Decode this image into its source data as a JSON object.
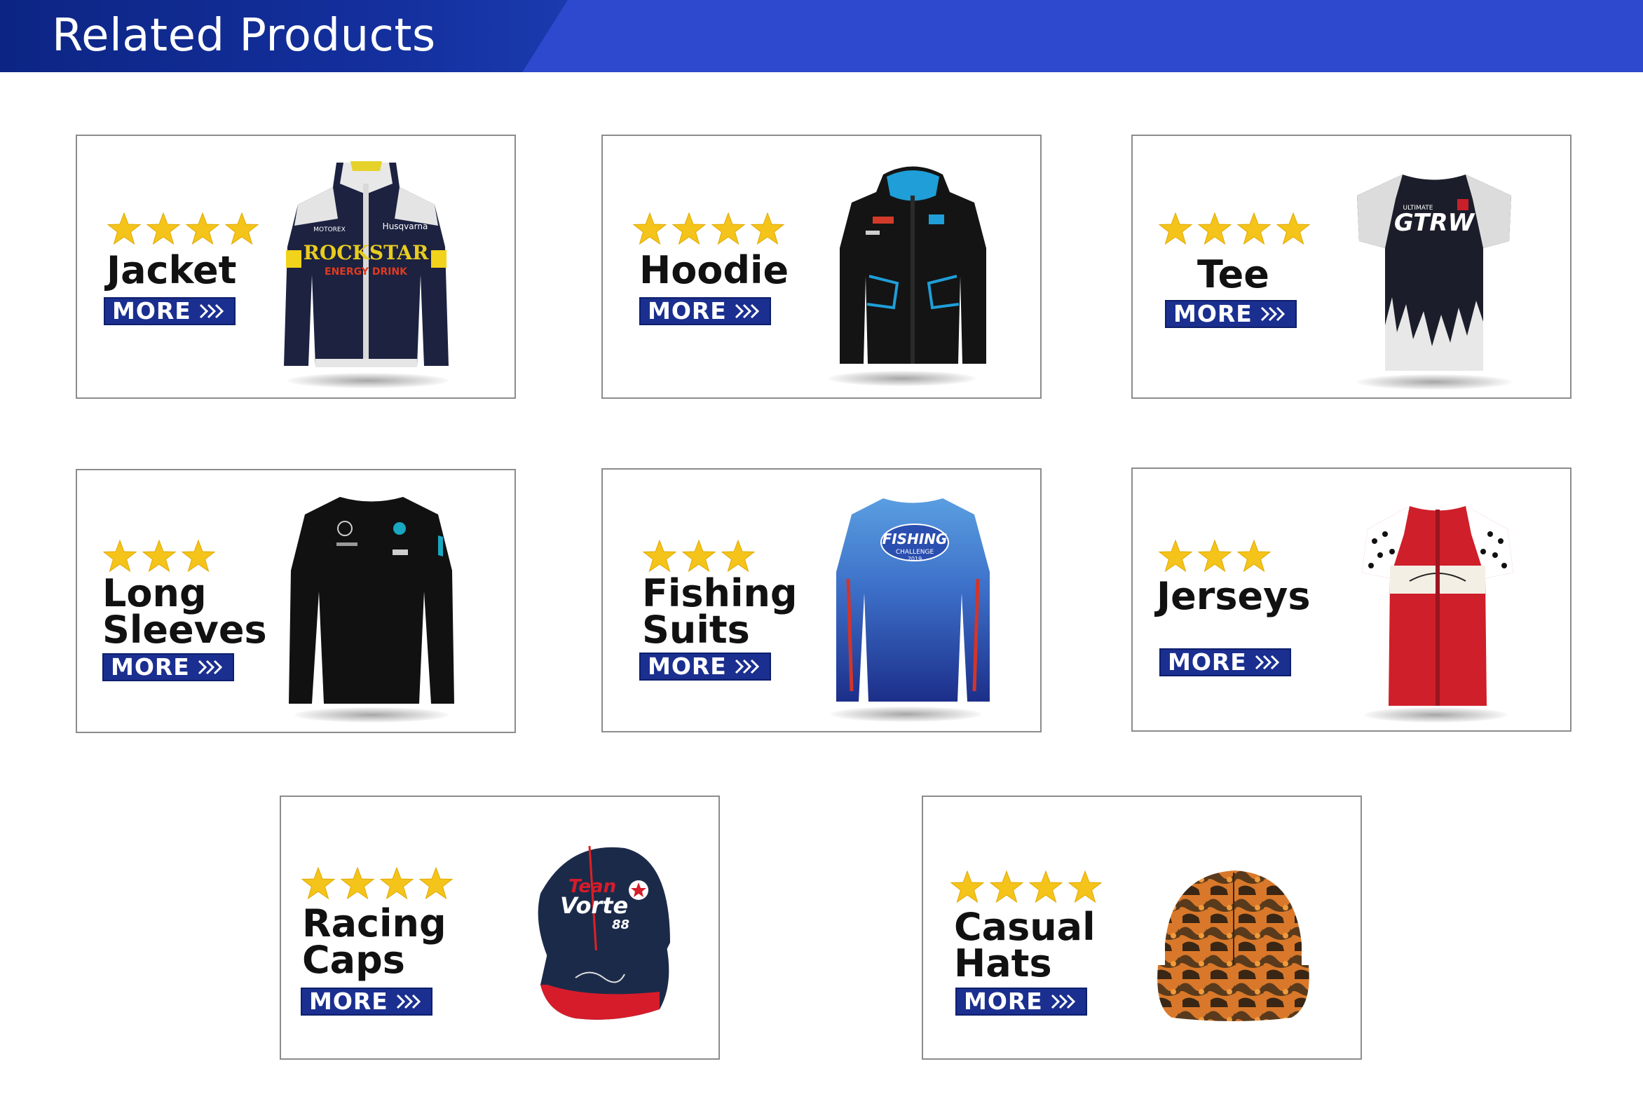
{
  "header": {
    "title": "Related Products"
  },
  "colors": {
    "header_bg": "#2e49cd",
    "header_dark": "#0c2584",
    "star": "#f5c41a",
    "button_bg": "#1a2f8f",
    "card_border": "#8c8c8c"
  },
  "products": [
    {
      "name": "Jacket",
      "stars": 4,
      "more_label": "MORE",
      "icon": "arrows-right-icon"
    },
    {
      "name": "Hoodie",
      "stars": 4,
      "more_label": "MORE",
      "icon": "arrows-right-icon"
    },
    {
      "name": "Tee",
      "stars": 4,
      "more_label": "MORE",
      "icon": "arrows-right-icon"
    },
    {
      "name_line1": "Long",
      "name_line2": "Sleeves",
      "stars": 3,
      "more_label": "MORE",
      "icon": "arrows-right-icon"
    },
    {
      "name_line1": "Fishing",
      "name_line2": "Suits",
      "stars": 3,
      "more_label": "MORE",
      "icon": "arrows-right-icon"
    },
    {
      "name": "Jerseys",
      "stars": 3,
      "more_label": "MORE",
      "icon": "arrows-right-icon"
    },
    {
      "name_line1": "Racing",
      "name_line2": "Caps",
      "stars": 4,
      "more_label": "MORE",
      "icon": "arrows-right-icon",
      "image_text": [
        "Tean",
        "Vorte",
        "88"
      ]
    },
    {
      "name_line1": "Casual",
      "name_line2": "Hats",
      "stars": 4,
      "more_label": "MORE",
      "icon": "arrows-right-icon"
    }
  ],
  "image_text": {
    "jacket": [
      "ROCKSTAR",
      "ENERGY DRINK",
      "Husqvarna",
      "MOTOREX"
    ],
    "tee": [
      "GTRW",
      "ULTIMATE"
    ],
    "fishing": [
      "FISHING",
      "CHALLENGE",
      "2019"
    ]
  }
}
